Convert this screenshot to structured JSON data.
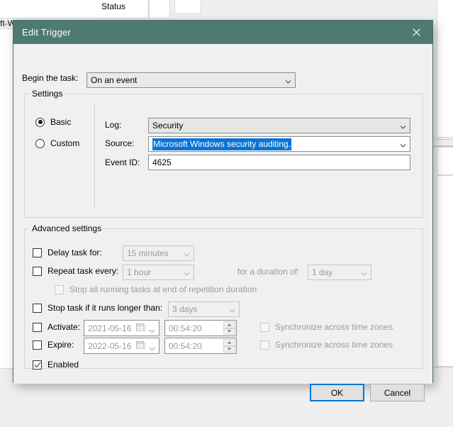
{
  "background": {
    "status_column_header": "Status",
    "left_text": "ft-W"
  },
  "dialog": {
    "title": "Edit Trigger",
    "close_icon": "close-icon",
    "begin_task": {
      "label": "Begin the task:",
      "value": "On an event",
      "chevron_icon": "chevron-down-icon"
    },
    "settings": {
      "group_title": "Settings",
      "mode_options": [
        {
          "label": "Basic",
          "selected": true
        },
        {
          "label": "Custom",
          "selected": false
        }
      ],
      "log": {
        "label": "Log:",
        "value": "Security",
        "chevron_icon": "chevron-down-icon"
      },
      "source": {
        "label": "Source:",
        "value": "Microsoft Windows security auditing.",
        "selected": true,
        "chevron_icon": "chevron-down-icon"
      },
      "event_id": {
        "label": "Event ID:",
        "value": "4625"
      }
    },
    "advanced": {
      "group_title": "Advanced settings",
      "delay_task": {
        "label": "Delay task for:",
        "checked": false,
        "value": "15 minutes",
        "enabled": false,
        "chevron_icon": "chevron-down-icon"
      },
      "repeat_task": {
        "label": "Repeat task every:",
        "checked": false,
        "value": "1 hour",
        "enabled": false,
        "chevron_icon": "chevron-down-icon"
      },
      "duration": {
        "label": "for a duration of:",
        "value": "1 day",
        "enabled": false,
        "chevron_icon": "chevron-down-icon"
      },
      "stop_all_running": {
        "label": "Stop all running tasks at end of repetition duration",
        "checked": false,
        "enabled": false
      },
      "stop_task_longer": {
        "label": "Stop task if it runs longer than:",
        "checked": false,
        "value": "3 days",
        "enabled": false,
        "chevron_icon": "chevron-down-icon"
      },
      "activate": {
        "label": "Activate:",
        "checked": false,
        "date": "2021-05-16",
        "time": "00:54:20",
        "sync_label": "Synchronize across time zones",
        "sync_checked": false,
        "calendar_icon": "calendar-icon",
        "spinner_icon": "spinner-updown-icon"
      },
      "expire": {
        "label": "Expire:",
        "checked": false,
        "date": "2022-05-16",
        "time": "00:54:20",
        "sync_label": "Synchronize across time zones",
        "sync_checked": false,
        "calendar_icon": "calendar-icon",
        "spinner_icon": "spinner-updown-icon"
      },
      "enabled": {
        "label": "Enabled",
        "checked": true
      }
    },
    "footer": {
      "ok_label": "OK",
      "cancel_label": "Cancel"
    }
  },
  "colors": {
    "titlebar": "#4d7b73",
    "selection": "#0a74d6",
    "focus_border": "#0078d7",
    "dialog_bg": "#f0f0f0"
  }
}
